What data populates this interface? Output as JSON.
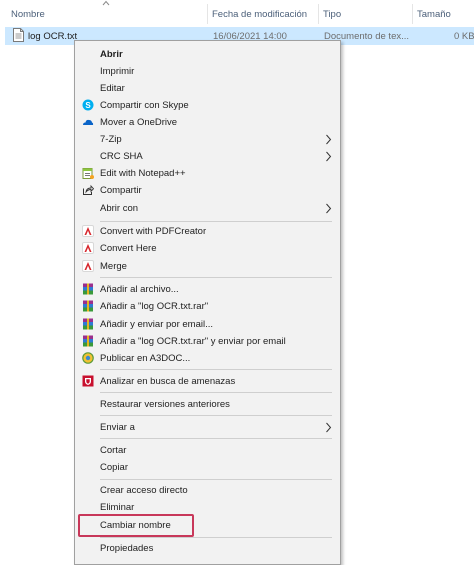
{
  "header": {
    "columns": [
      "Nombre",
      "Fecha de modificación",
      "Tipo",
      "Tamaño"
    ]
  },
  "file": {
    "name": "log OCR.txt",
    "date": "16/06/2021 14:00",
    "type": "Documento de tex...",
    "size": "0 KB"
  },
  "menu": {
    "items": [
      {
        "label": "Abrir",
        "icon": "none"
      },
      {
        "label": "Imprimir",
        "icon": "none"
      },
      {
        "label": "Editar",
        "icon": "none"
      },
      {
        "label": "Compartir con Skype",
        "icon": "skype-icon"
      },
      {
        "label": "Mover a OneDrive",
        "icon": "onedrive-icon"
      },
      {
        "label": "7-Zip",
        "icon": "none",
        "submenu": true
      },
      {
        "label": "CRC SHA",
        "icon": "none",
        "submenu": true
      },
      {
        "label": "Edit with Notepad++",
        "icon": "notepad-plus-plus-icon"
      },
      {
        "label": "Compartir",
        "icon": "share-icon"
      },
      {
        "label": "Abrir con",
        "icon": "none",
        "submenu": true
      },
      {
        "label": "Convert with PDFCreator",
        "icon": "pdfcreator-icon"
      },
      {
        "label": "Convert Here",
        "icon": "pdfcreator-icon"
      },
      {
        "label": "Merge",
        "icon": "pdfcreator-icon"
      },
      {
        "label": "Añadir al archivo...",
        "icon": "winrar-icon"
      },
      {
        "label": "Añadir a \"log OCR.txt.rar\"",
        "icon": "winrar-icon"
      },
      {
        "label": "Añadir y enviar por email...",
        "icon": "winrar-icon"
      },
      {
        "label": "Añadir a \"log OCR.txt.rar\" y enviar por email",
        "icon": "winrar-icon"
      },
      {
        "label": "Publicar en A3DOC...",
        "icon": "a3doc-icon"
      },
      {
        "label": "Analizar en busca de amenazas",
        "icon": "antivirus-icon"
      },
      {
        "label": "Restaurar versiones anteriores",
        "icon": "none"
      },
      {
        "label": "Enviar a",
        "icon": "none",
        "submenu": true
      },
      {
        "label": "Cortar",
        "icon": "none"
      },
      {
        "label": "Copiar",
        "icon": "none"
      },
      {
        "label": "Crear acceso directo",
        "icon": "none"
      },
      {
        "label": "Eliminar",
        "icon": "none"
      },
      {
        "label": "Cambiar nombre",
        "icon": "none"
      },
      {
        "label": "Propiedades",
        "icon": "none"
      }
    ],
    "highlighted": "Cambiar nombre",
    "highlight_color": "#c8385a"
  }
}
